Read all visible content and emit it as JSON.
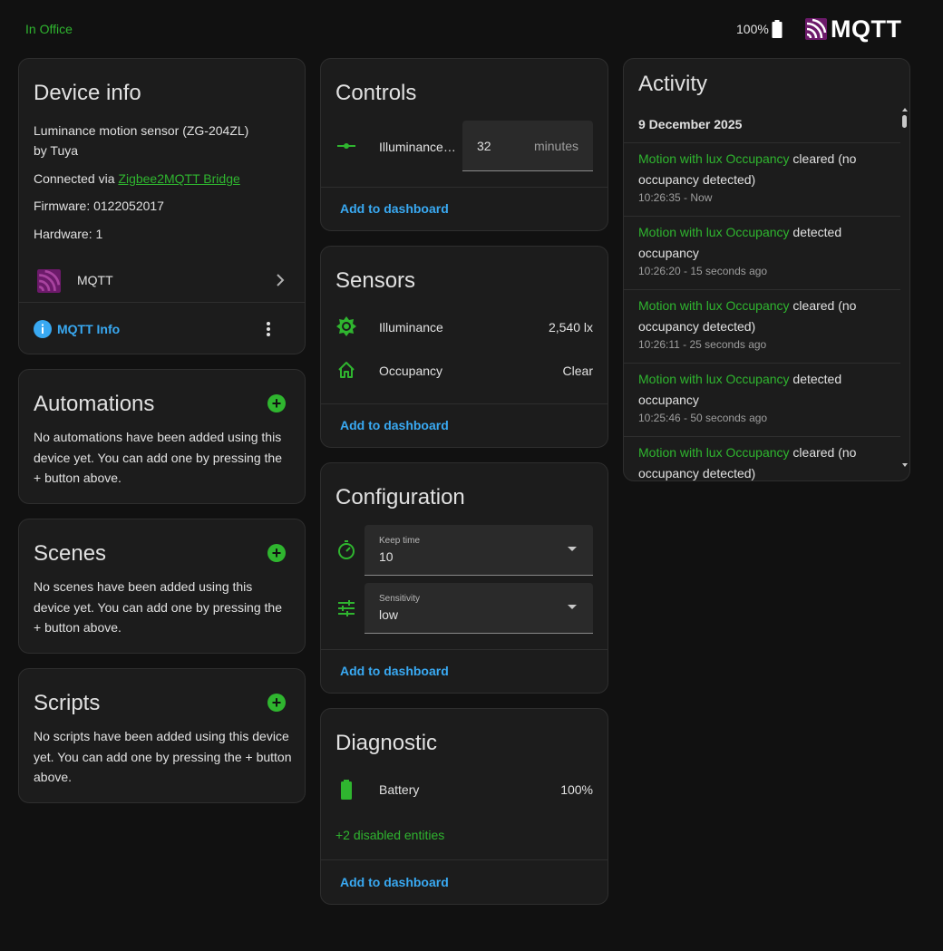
{
  "topbar": {
    "area": "In Office",
    "battery": "100%",
    "brand": "MQTT"
  },
  "device_info": {
    "title": "Device info",
    "model": "Luminance motion sensor (ZG-204ZL)",
    "manufacturer": "by Tuya",
    "connected_prefix": "Connected via ",
    "connected_link": "Zigbee2MQTT Bridge",
    "firmware": "Firmware: 0122052017",
    "hardware": "Hardware: 1",
    "integration": "MQTT",
    "info_link": "MQTT Info"
  },
  "automations": {
    "title": "Automations",
    "text": "No automations have been added using this device yet. You can add one by pressing the + button above."
  },
  "scenes": {
    "title": "Scenes",
    "text": "No scenes have been added using this device yet. You can add one by pressing the + button above."
  },
  "scripts": {
    "title": "Scripts",
    "text": "No scripts have been added using this device yet. You can add one by pressing the + button above."
  },
  "controls": {
    "title": "Controls",
    "row_label": "Illuminance…",
    "field_value": "32",
    "field_unit": "minutes",
    "add": "Add to dashboard"
  },
  "sensors": {
    "title": "Sensors",
    "rows": [
      {
        "label": "Illuminance",
        "value": "2,540 lx"
      },
      {
        "label": "Occupancy",
        "value": "Clear"
      }
    ],
    "add": "Add to dashboard"
  },
  "configuration": {
    "title": "Configuration",
    "fields": [
      {
        "label": "Keep time",
        "value": "10"
      },
      {
        "label": "Sensitivity",
        "value": "low"
      }
    ],
    "add": "Add to dashboard"
  },
  "diagnostic": {
    "title": "Diagnostic",
    "battery_label": "Battery",
    "battery_value": "100%",
    "disabled": "+2 disabled entities",
    "add": "Add to dashboard"
  },
  "activity": {
    "title": "Activity",
    "date": "9 December 2025",
    "entries": [
      {
        "entity": "Motion with lux Occupancy",
        "action": " cleared (no occupancy detected)",
        "time": "10:26:35 - Now"
      },
      {
        "entity": "Motion with lux Occupancy",
        "action": " detected occupancy",
        "time": "10:26:20 - 15 seconds ago"
      },
      {
        "entity": "Motion with lux Occupancy",
        "action": " cleared (no occupancy detected)",
        "time": "10:26:11 - 25 seconds ago"
      },
      {
        "entity": "Motion with lux Occupancy",
        "action": " detected occupancy",
        "time": "10:25:46 - 50 seconds ago"
      },
      {
        "entity": "Motion with lux Occupancy",
        "action": " cleared (no occupancy detected)",
        "time": ""
      }
    ]
  },
  "colors": {
    "background": "#111111",
    "card": "#1c1c1c",
    "accent_green": "#2fb52f",
    "link_blue": "#39a9f2",
    "mqtt_purple": "#6c1a6a"
  }
}
